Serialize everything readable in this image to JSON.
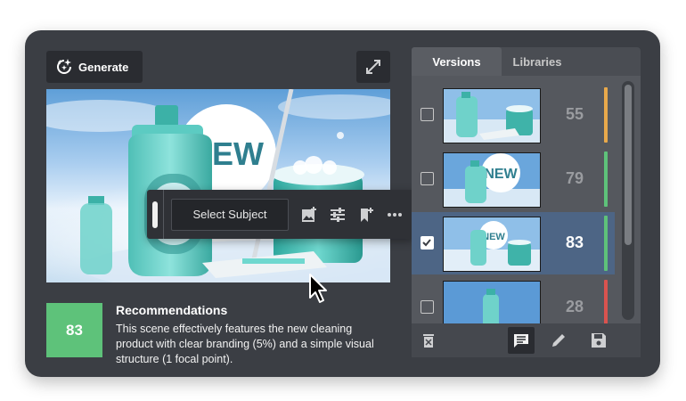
{
  "toolbar": {
    "generate_label": "Generate",
    "select_subject_label": "Select Subject"
  },
  "canvas": {
    "new_text": "NEW"
  },
  "recommendation": {
    "score": "83",
    "title": "Recommendations",
    "text": "This scene effectively features the new cleaning product with clear branding (5%) and a simple visual structure (1 focal point)."
  },
  "sidebar": {
    "tabs": [
      {
        "label": "Versions",
        "active": true
      },
      {
        "label": "Libraries",
        "active": false
      }
    ],
    "versions": [
      {
        "score": "55",
        "checked": false,
        "bar_color": "#e9a94b"
      },
      {
        "score": "79",
        "checked": false,
        "bar_color": "#5ec27a"
      },
      {
        "score": "83",
        "checked": true,
        "bar_color": "#5ec27a"
      },
      {
        "score": "28",
        "checked": false,
        "bar_color": "#d9534f"
      }
    ]
  },
  "icons": {
    "generate": "sparkle-refresh-icon",
    "expand": "expand-arrows-icon",
    "image_add": "image-add-icon",
    "adjust": "sliders-icon",
    "bookmark_add": "bookmark-add-icon",
    "more": "more-horizontal-icon",
    "delete": "delete-icon",
    "comment": "comment-icon",
    "edit": "pencil-icon",
    "save": "save-icon"
  },
  "colors": {
    "panel": "#3b3e44",
    "accent_green": "#5ec27a",
    "selected_row": "#4d6585"
  }
}
